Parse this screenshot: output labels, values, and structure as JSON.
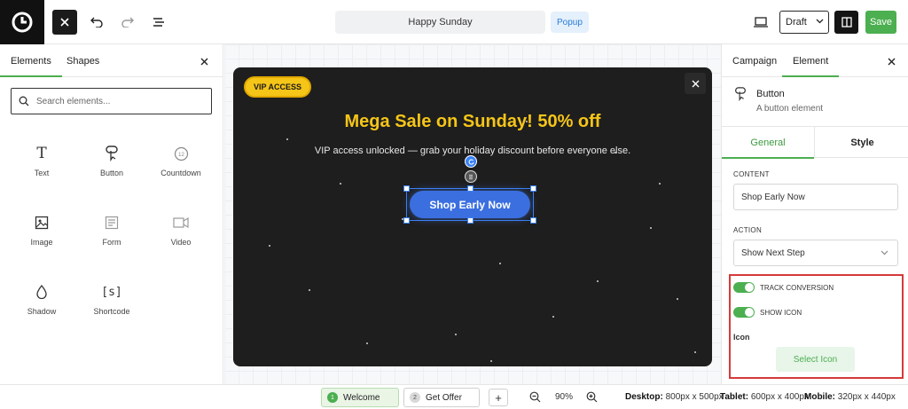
{
  "header": {
    "popup_title": "Happy Sunday",
    "type_badge": "Popup",
    "status_select": "Draft",
    "save_label": "Save"
  },
  "left_panel": {
    "tabs": [
      "Elements",
      "Shapes"
    ],
    "search_placeholder": "Search elements...",
    "elements": [
      {
        "label": "Text",
        "icon": "text-icon"
      },
      {
        "label": "Button",
        "icon": "button-icon"
      },
      {
        "label": "Countdown",
        "icon": "countdown-icon"
      },
      {
        "label": "Image",
        "icon": "image-icon"
      },
      {
        "label": "Form",
        "icon": "form-icon"
      },
      {
        "label": "Video",
        "icon": "video-icon"
      },
      {
        "label": "Shadow",
        "icon": "shadow-icon"
      },
      {
        "label": "Shortcode",
        "icon": "shortcode-icon"
      }
    ]
  },
  "canvas": {
    "badge": "VIP ACCESS",
    "headline": "Mega Sale on Sunday! 50% off",
    "subline": "VIP access unlocked — grab your holiday discount before everyone else.",
    "cta": "Shop Early Now",
    "countdown_icon_glyph": "12",
    "shortcode_icon_glyph": "[s]",
    "text_icon_glyph": "T"
  },
  "right_panel": {
    "tabs": [
      "Campaign",
      "Element"
    ],
    "element_title": "Button",
    "element_subtitle": "A button element",
    "sub_tabs": [
      "General",
      "Style"
    ],
    "content_label": "CONTENT",
    "content_value": "Shop Early Now",
    "action_label": "ACTION",
    "action_value": "Show Next Step",
    "toggles": [
      {
        "label": "TRACK CONVERSION",
        "on": true
      },
      {
        "label": "SHOW ICON",
        "on": true
      }
    ],
    "icon_label": "Icon",
    "select_icon_label": "Select Icon"
  },
  "footer": {
    "steps": [
      {
        "num": "1",
        "label": "Welcome"
      },
      {
        "num": "2",
        "label": "Get Offer"
      }
    ],
    "add_step": "+",
    "zoom": "90%",
    "desktop_label": "Desktop:",
    "desktop_value": "800px x 500px",
    "tablet_label": "Tablet:",
    "tablet_value": "600px x 400px",
    "mobile_label": "Mobile:",
    "mobile_value": "320px x 440px"
  },
  "colors": {
    "accent_green": "#4caf50",
    "headline_yellow": "#f5c518",
    "cta_blue": "#3b6fe0",
    "highlight_red": "#d63a3a"
  }
}
